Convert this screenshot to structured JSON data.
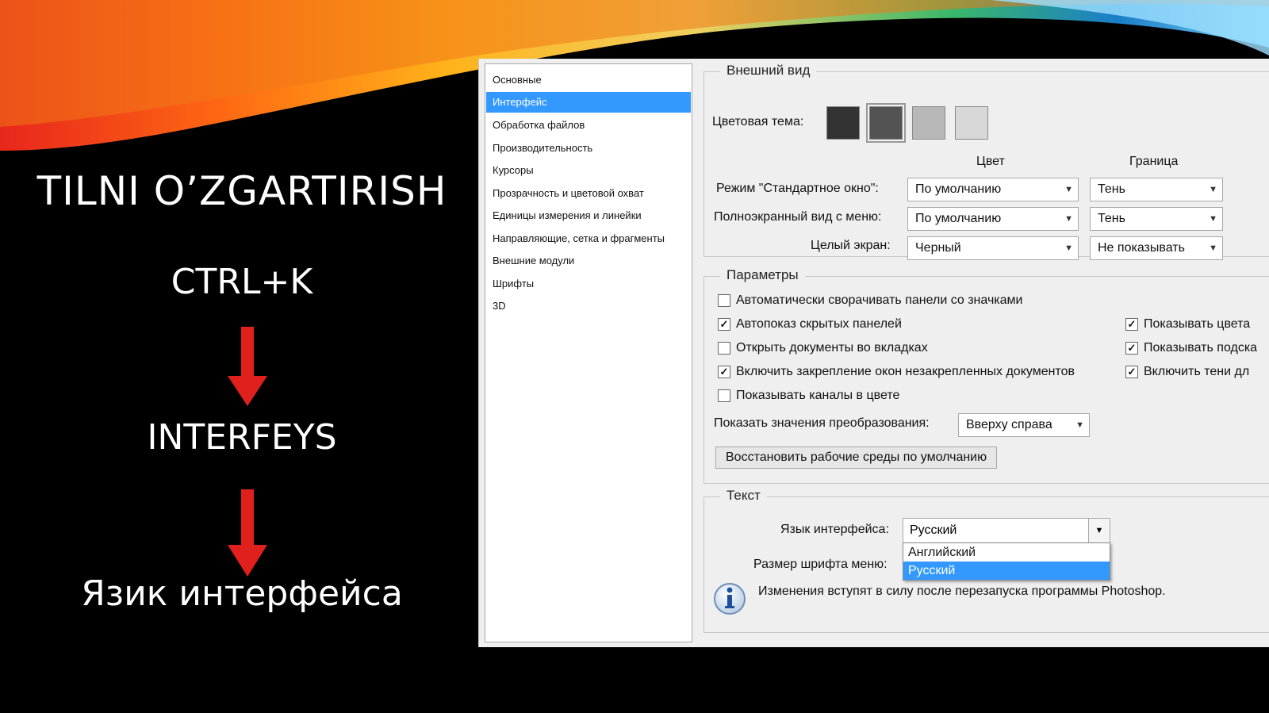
{
  "slide": {
    "title": "TILNI O’ZGARTIRISH",
    "shortcut": "CTRL+K",
    "step2": "INTERFEYS",
    "step3": "Язик интерфейса"
  },
  "sidebar": {
    "items": [
      {
        "label": "Основные",
        "active": false
      },
      {
        "label": "Интерфейс",
        "active": true
      },
      {
        "label": "Обработка файлов",
        "active": false
      },
      {
        "label": "Производительность",
        "active": false
      },
      {
        "label": "Курсоры",
        "active": false
      },
      {
        "label": "Прозрачность и цветовой охват",
        "active": false
      },
      {
        "label": "Единицы измерения и линейки",
        "active": false
      },
      {
        "label": "Направляющие, сетка и фрагменты",
        "active": false
      },
      {
        "label": "Внешние модули",
        "active": false
      },
      {
        "label": "Шрифты",
        "active": false
      },
      {
        "label": "3D",
        "active": false
      }
    ]
  },
  "appearance": {
    "title": "Внешний вид",
    "color_theme_label": "Цветовая тема:",
    "swatches": [
      "#333333",
      "#535353",
      "#b8b8b8",
      "#d8d8d8"
    ],
    "col_color": "Цвет",
    "col_border": "Граница",
    "rows": [
      {
        "label": "Режим \"Стандартное окно\":",
        "color": "По умолчанию",
        "border": "Тень"
      },
      {
        "label": "Полноэкранный вид с меню:",
        "color": "По умолчанию",
        "border": "Тень"
      },
      {
        "label": "Целый экран:",
        "color": "Черный",
        "border": "Не показывать"
      }
    ]
  },
  "params": {
    "title": "Параметры",
    "left_checkboxes": [
      {
        "label": "Автоматически сворачивать панели со значками",
        "checked": false
      },
      {
        "label": "Автопоказ скрытых панелей",
        "checked": true
      },
      {
        "label": "Открыть документы во вкладках",
        "checked": false
      },
      {
        "label": "Включить закрепление окон незакрепленных документов",
        "checked": true
      },
      {
        "label": "Показывать каналы в цвете",
        "checked": false
      }
    ],
    "right_checkboxes": [
      {
        "label": "Показывать цвета",
        "checked": true
      },
      {
        "label": "Показывать подска",
        "checked": true
      },
      {
        "label": "Включить тени дл",
        "checked": true
      }
    ],
    "transform_label": "Показать значения преобразования:",
    "transform_value": "Вверху справа",
    "restore_button": "Восстановить рабочие среды по умолчанию"
  },
  "text_section": {
    "title": "Текст",
    "lang_label": "Язык интерфейса:",
    "lang_value": "Русский",
    "lang_options": [
      "Английский",
      "Русский"
    ],
    "lang_selected": "Русский",
    "font_size_label": "Размер шрифта меню:",
    "info_text": "Изменения вступят в силу после перезапуска программы Photoshop."
  }
}
